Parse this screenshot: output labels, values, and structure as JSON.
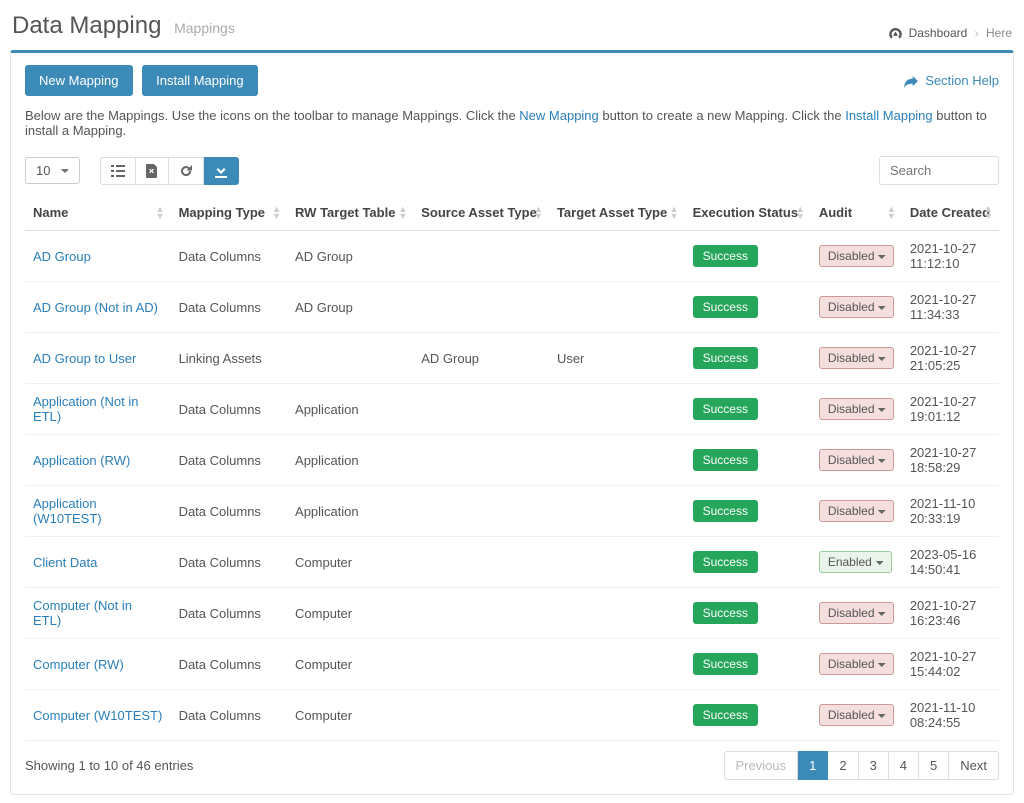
{
  "header": {
    "title": "Data Mapping",
    "subtitle": "Mappings",
    "breadcrumb_dashboard": "Dashboard",
    "breadcrumb_here": "Here"
  },
  "toolbar": {
    "new_mapping": "New Mapping",
    "install_mapping": "Install Mapping",
    "section_help": "Section Help"
  },
  "intro": {
    "prefix": "Below are the Mappings. Use the icons on the toolbar to manage Mappings. Click the ",
    "link1": "New Mapping",
    "mid": " button to create a new Mapping. Click the ",
    "link2": "Install Mapping",
    "suffix": " button to install a Mapping."
  },
  "controls": {
    "page_size": "10",
    "search_placeholder": "Search"
  },
  "columns": [
    "Name",
    "Mapping Type",
    "RW Target Table",
    "Source Asset Type",
    "Target Asset Type",
    "Execution Status",
    "Audit",
    "Date Created"
  ],
  "audit_options": {
    "disabled": "Disabled",
    "enabled": "Enabled"
  },
  "rows": [
    {
      "name": "AD Group",
      "type": "Data Columns",
      "target": "AD Group",
      "source_asset": "",
      "target_asset": "",
      "status": "Success",
      "audit": "disabled",
      "date": "2021-10-27 11:12:10"
    },
    {
      "name": "AD Group (Not in AD)",
      "type": "Data Columns",
      "target": "AD Group",
      "source_asset": "",
      "target_asset": "",
      "status": "Success",
      "audit": "disabled",
      "date": "2021-10-27 11:34:33"
    },
    {
      "name": "AD Group to User",
      "type": "Linking Assets",
      "target": "",
      "source_asset": "AD Group",
      "target_asset": "User",
      "status": "Success",
      "audit": "disabled",
      "date": "2021-10-27 21:05:25"
    },
    {
      "name": "Application (Not in ETL)",
      "type": "Data Columns",
      "target": "Application",
      "source_asset": "",
      "target_asset": "",
      "status": "Success",
      "audit": "disabled",
      "date": "2021-10-27 19:01:12"
    },
    {
      "name": "Application (RW)",
      "type": "Data Columns",
      "target": "Application",
      "source_asset": "",
      "target_asset": "",
      "status": "Success",
      "audit": "disabled",
      "date": "2021-10-27 18:58:29"
    },
    {
      "name": "Application (W10TEST)",
      "type": "Data Columns",
      "target": "Application",
      "source_asset": "",
      "target_asset": "",
      "status": "Success",
      "audit": "disabled",
      "date": "2021-11-10 20:33:19"
    },
    {
      "name": "Client Data",
      "type": "Data Columns",
      "target": "Computer",
      "source_asset": "",
      "target_asset": "",
      "status": "Success",
      "audit": "enabled",
      "date": "2023-05-16 14:50:41"
    },
    {
      "name": "Computer (Not in ETL)",
      "type": "Data Columns",
      "target": "Computer",
      "source_asset": "",
      "target_asset": "",
      "status": "Success",
      "audit": "disabled",
      "date": "2021-10-27 16:23:46"
    },
    {
      "name": "Computer (RW)",
      "type": "Data Columns",
      "target": "Computer",
      "source_asset": "",
      "target_asset": "",
      "status": "Success",
      "audit": "disabled",
      "date": "2021-10-27 15:44:02"
    },
    {
      "name": "Computer (W10TEST)",
      "type": "Data Columns",
      "target": "Computer",
      "source_asset": "",
      "target_asset": "",
      "status": "Success",
      "audit": "disabled",
      "date": "2021-11-10 08:24:55"
    }
  ],
  "footer": {
    "info": "Showing 1 to 10 of 46 entries",
    "previous": "Previous",
    "next": "Next",
    "pages": [
      "1",
      "2",
      "3",
      "4",
      "5"
    ],
    "active_page": 0
  }
}
